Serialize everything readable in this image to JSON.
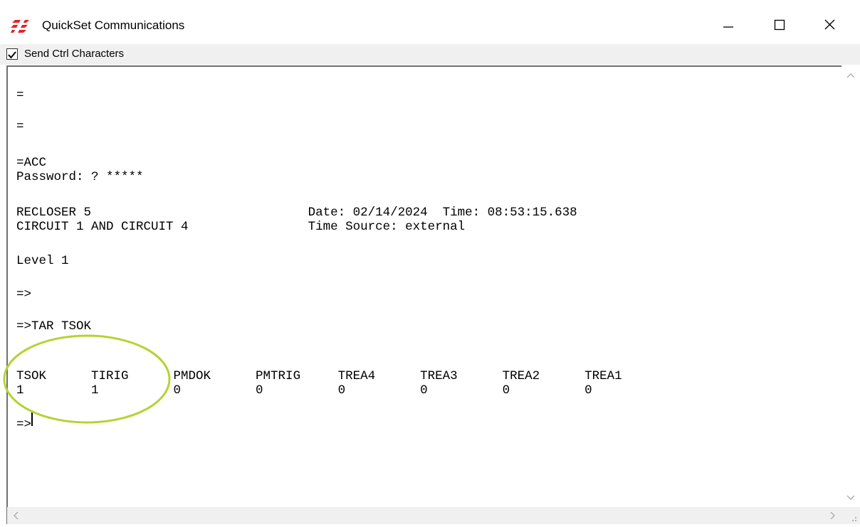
{
  "window": {
    "title": "QuickSet Communications",
    "icon": "quickset-logo-icon",
    "brand_color": "#e8202a",
    "controls": {
      "minimize": "minimize-icon",
      "maximize": "maximize-icon",
      "close": "close-icon"
    }
  },
  "options": {
    "send_ctrl_characters": {
      "label": "Send Ctrl Characters",
      "checked": true
    }
  },
  "terminal": {
    "lines": [
      "=",
      "=",
      "=ACC",
      "Password: ? *****",
      "RECLOSER 5                             Date: 02/14/2024  Time: 08:53:15.638",
      "CIRCUIT 1 AND CIRCUIT 4                Time Source: external",
      "Level 1",
      "=>",
      "=>TAR TSOK",
      "TSOK      TIRIG      PMDOK      PMTRIG     TREA4      TREA3      TREA2      TREA1",
      "1         1          0          0          0          0          0          0",
      "=>"
    ],
    "highlight_color": "#b5d334",
    "highlighted_fields": [
      "TSOK",
      "TIRIG"
    ]
  }
}
